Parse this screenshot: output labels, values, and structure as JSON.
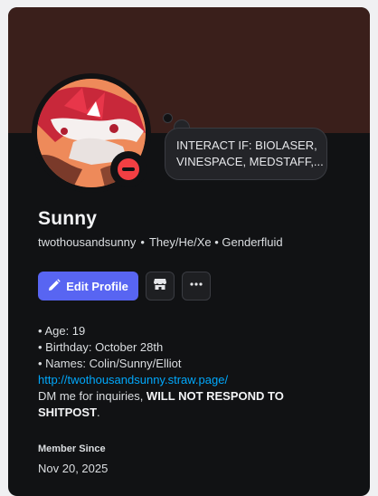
{
  "profile": {
    "display_name": "Sunny",
    "username": "twothousandsunny",
    "separator": "•",
    "pronouns": "They/He/Xe • Genderfluid",
    "status": "do-not-disturb",
    "custom_status": {
      "line1": "INTERACT IF: BIOLASER,",
      "line2": "VINESPACE, MEDSTAFF,..."
    }
  },
  "actions": {
    "edit_label": "Edit Profile",
    "edit_icon": "pencil-icon",
    "shop_icon": "shop-icon",
    "more_icon": "more-horizontal-icon"
  },
  "bio": {
    "age": "• Age: 19",
    "birthday": "• Birthday: October 28th",
    "names": "• Names: Colin/Sunny/Elliot",
    "link": "http://twothousandsunny.straw.page/",
    "dm_prefix": "DM me for inquiries, ",
    "dm_bold_1": "WILL NOT RESPOND TO",
    "dm_bold_2": "SHITPOST",
    "dm_suffix": "."
  },
  "member_since": {
    "label": "Member Since",
    "date": "Nov 20, 2025"
  },
  "colors": {
    "card": "#111214",
    "banner": "#3a1f1b",
    "accent": "#5865f2",
    "link": "#00a8fc",
    "dnd": "#f23f43"
  }
}
